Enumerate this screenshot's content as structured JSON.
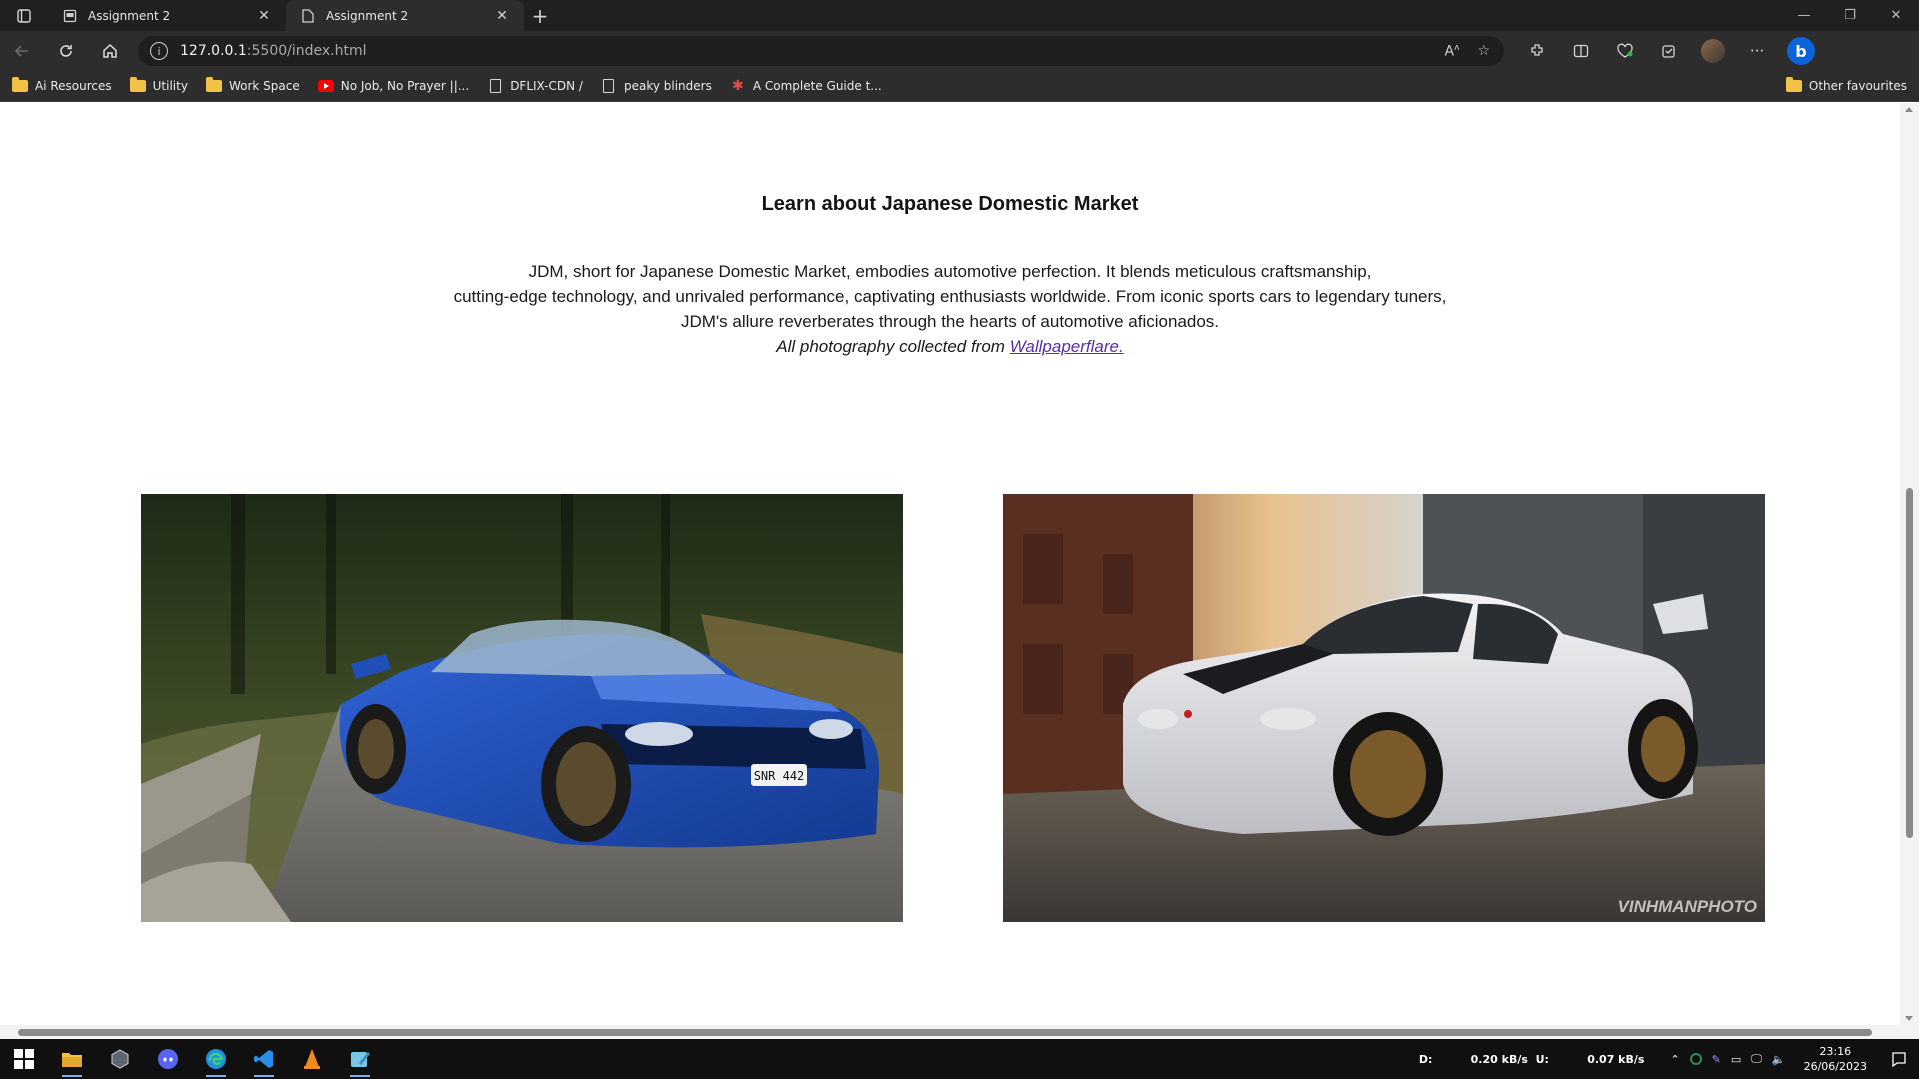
{
  "browser": {
    "tabs": [
      {
        "title": "Assignment 2",
        "active": false
      },
      {
        "title": "Assignment 2",
        "active": true
      }
    ],
    "address": {
      "host": "127.0.0.1",
      "path": ":5500/index.html"
    },
    "favorites": [
      {
        "label": "Ai Resources",
        "icon": "folder-icon"
      },
      {
        "label": "Utility",
        "icon": "folder-icon"
      },
      {
        "label": "Work Space",
        "icon": "folder-icon"
      },
      {
        "label": "No Job, No Prayer ||...",
        "icon": "youtube-icon"
      },
      {
        "label": "DFLIX-CDN /",
        "icon": "page-icon"
      },
      {
        "label": "peaky blinders",
        "icon": "page-icon"
      },
      {
        "label": "A Complete Guide t...",
        "icon": "star-icon"
      }
    ],
    "other_favourites": "Other favourites"
  },
  "page": {
    "heading": "Learn about Japanese Domestic Market",
    "intro_lines": [
      "JDM, short for Japanese Domestic Market, embodies automotive perfection. It blends meticulous craftsmanship,",
      "cutting-edge technology, and unrivaled performance, captivating enthusiasts worldwide. From iconic sports cars to legendary tuners,",
      "JDM's allure reverberates through the hearts of automotive aficionados."
    ],
    "credit_prefix": "All photography collected from ",
    "credit_link": "Wallpaperflare.",
    "photos": [
      {
        "plate": "SNR 442",
        "color": "#1f4fb8"
      },
      {
        "watermark": "VINHMANPHOTO",
        "color": "#e9e9ec"
      }
    ]
  },
  "taskbar": {
    "net_down_label": "D:",
    "net_down": "0.20 kB/s",
    "net_up_label": "U:",
    "net_up": "0.07 kB/s",
    "time": "23:16",
    "date": "26/06/2023"
  },
  "colors": {
    "link": "#5a2ea6",
    "accent": "#0a63d8"
  }
}
